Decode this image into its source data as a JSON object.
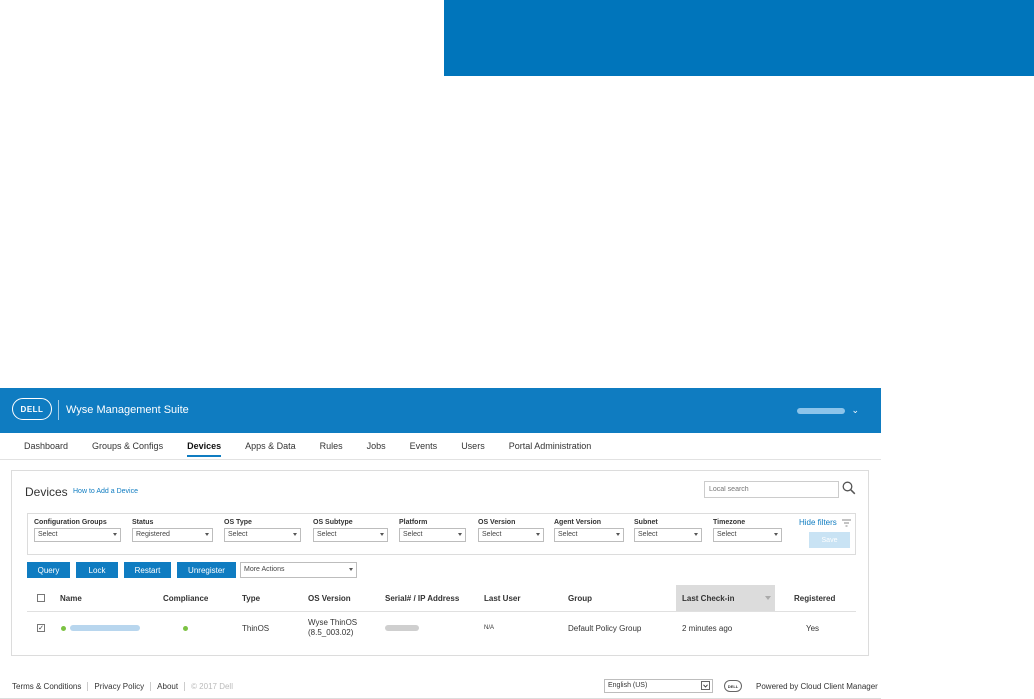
{
  "header": {
    "logo_text": "DELL",
    "app_title": "Wyse Management Suite",
    "user_caret": "⌄"
  },
  "nav": {
    "items": [
      {
        "label": "Dashboard"
      },
      {
        "label": "Groups & Configs"
      },
      {
        "label": "Devices",
        "active": true
      },
      {
        "label": "Apps & Data"
      },
      {
        "label": "Rules"
      },
      {
        "label": "Jobs"
      },
      {
        "label": "Events"
      },
      {
        "label": "Users"
      },
      {
        "label": "Portal Administration"
      }
    ]
  },
  "page": {
    "title": "Devices",
    "help_link": "How to Add a Device",
    "search_placeholder": "Local search"
  },
  "filters": {
    "items": [
      {
        "label": "Configuration Groups",
        "value": "Select"
      },
      {
        "label": "Status",
        "value": "Registered"
      },
      {
        "label": "OS Type",
        "value": "Select"
      },
      {
        "label": "OS Subtype",
        "value": "Select"
      },
      {
        "label": "Platform",
        "value": "Select"
      },
      {
        "label": "OS Version",
        "value": "Select"
      },
      {
        "label": "Agent Version",
        "value": "Select"
      },
      {
        "label": "Subnet",
        "value": "Select"
      },
      {
        "label": "Timezone",
        "value": "Select"
      }
    ],
    "hide_label": "Hide filters",
    "save_label": "Save"
  },
  "actions": {
    "query": "Query",
    "lock": "Lock",
    "restart": "Restart",
    "unregister": "Unregister",
    "more_actions": "More Actions"
  },
  "table": {
    "columns": [
      "Name",
      "Compliance",
      "Type",
      "OS Version",
      "Serial# / IP Address",
      "Last User",
      "Group",
      "Last Check-in",
      "Registered"
    ],
    "rows": [
      {
        "type": "ThinOS",
        "os_version_line1": "Wyse ThinOS",
        "os_version_line2": "(8.5_003.02)",
        "last_user": "N/A",
        "group": "Default Policy Group",
        "last_checkin": "2 minutes ago",
        "registered": "Yes",
        "checked": true
      }
    ]
  },
  "footer": {
    "terms": "Terms & Conditions",
    "privacy": "Privacy Policy",
    "about": "About",
    "copyright": "© 2017 Dell",
    "language": "English (US)",
    "powered_by": "Powered by Cloud Client Manager"
  },
  "colors": {
    "brand_blue": "#0f7cc1",
    "banner_blue": "#0075bb",
    "status_green": "#7cc243"
  }
}
